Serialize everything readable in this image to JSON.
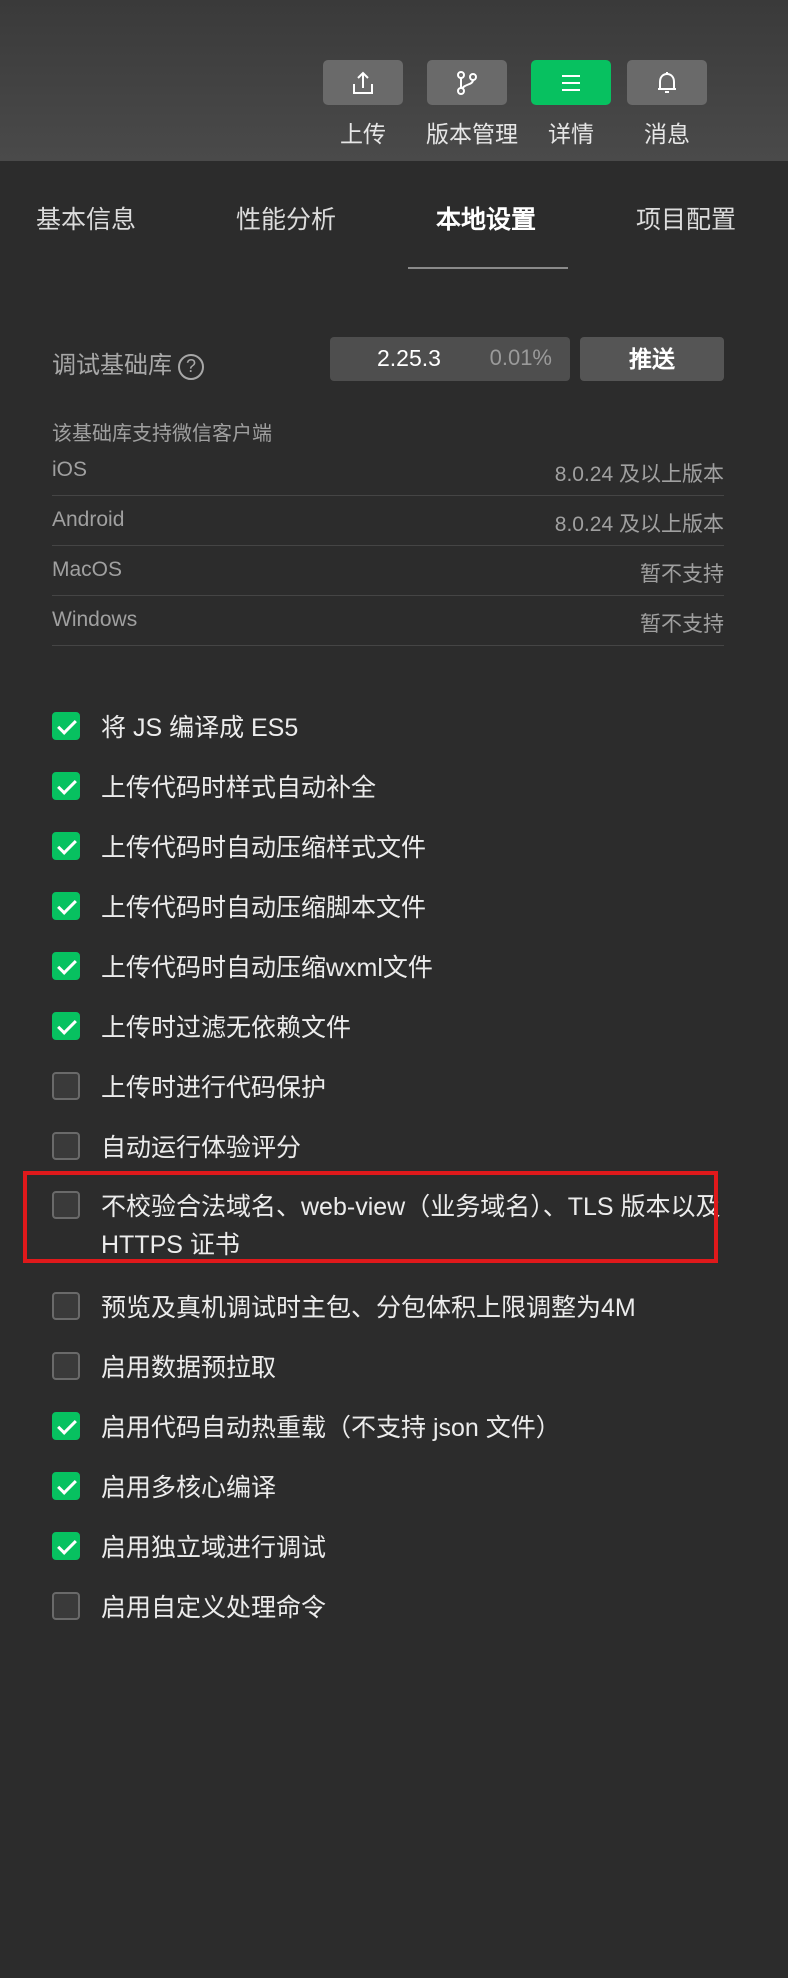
{
  "toolbar": {
    "buttons": [
      {
        "label": "上传",
        "icon": "upload-icon"
      },
      {
        "label": "版本管理",
        "icon": "branch-icon"
      },
      {
        "label": "详情",
        "icon": "menu-icon",
        "active": true
      },
      {
        "label": "消息",
        "icon": "bell-icon"
      }
    ],
    "accent": "#07c160"
  },
  "tabs": [
    "基本信息",
    "性能分析",
    "本地设置",
    "项目配置"
  ],
  "active_tab": "本地设置",
  "base_lib": {
    "label": "调试基础库",
    "help": "?",
    "version": "2.25.3",
    "percent": "0.01%",
    "push_label": "推送"
  },
  "support": {
    "title": "该基础库支持微信客户端",
    "rows": [
      {
        "platform": "iOS",
        "value": "8.0.24 及以上版本"
      },
      {
        "platform": "Android",
        "value": "8.0.24 及以上版本"
      },
      {
        "platform": "MacOS",
        "value": "暂不支持"
      },
      {
        "platform": "Windows",
        "value": "暂不支持"
      }
    ]
  },
  "options": [
    {
      "label": "将 JS 编译成 ES5",
      "checked": true
    },
    {
      "label": "上传代码时样式自动补全",
      "checked": true
    },
    {
      "label": "上传代码时自动压缩样式文件",
      "checked": true
    },
    {
      "label": "上传代码时自动压缩脚本文件",
      "checked": true
    },
    {
      "label": "上传代码时自动压缩wxml文件",
      "checked": true
    },
    {
      "label": "上传时过滤无依赖文件",
      "checked": true
    },
    {
      "label": "上传时进行代码保护",
      "checked": false
    },
    {
      "label": "自动运行体验评分",
      "checked": false
    },
    {
      "label": "不校验合法域名、web-view（业务域名）、TLS 版本以及 HTTPS 证书",
      "checked": false,
      "highlighted": true
    },
    {
      "label": "预览及真机调试时主包、分包体积上限调整为4M",
      "checked": false
    },
    {
      "label": "启用数据预拉取",
      "checked": false
    },
    {
      "label": "启用代码自动热重载（不支持 json 文件）",
      "checked": true
    },
    {
      "label": "启用多核心编译",
      "checked": true
    },
    {
      "label": "启用独立域进行调试",
      "checked": true
    },
    {
      "label": "启用自定义处理命令",
      "checked": false
    }
  ],
  "colors": {
    "checked": "#07c160",
    "highlight_border": "#e0191b",
    "background": "#2c2c2c"
  }
}
